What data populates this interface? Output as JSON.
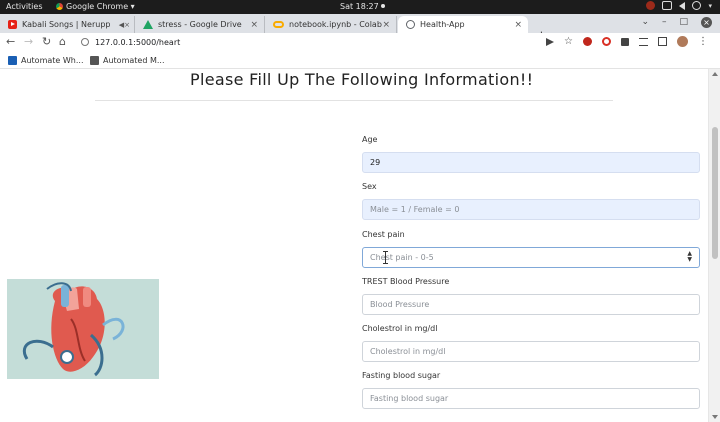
{
  "os_topbar": {
    "activities": "Activities",
    "app_name": "Google Chrome",
    "clock": "Sat 18:27"
  },
  "tabs": [
    {
      "title": "Kabali Songs | Nerupp",
      "icon": "youtube-icon",
      "media": "◀×"
    },
    {
      "title": "stress - Google Drive",
      "icon": "drive-icon"
    },
    {
      "title": "notebook.ipynb - Colabo",
      "icon": "colab-icon"
    },
    {
      "title": "Health-App",
      "icon": "globe-icon",
      "active": true
    }
  ],
  "toolbar": {
    "url": "127.0.0.1:5000/heart"
  },
  "bookmarks": [
    {
      "label": "Automate Wh...",
      "icon": "apps-icon"
    },
    {
      "label": "Automated M...",
      "icon": "document-icon"
    }
  ],
  "page": {
    "title": "Please Fill Up The Following Information!!",
    "image_colors": {
      "background": "#c4ddd8",
      "heart": "#e05a4f",
      "stethoscope": "#3b6e8f"
    },
    "form": {
      "fields": [
        {
          "label": "Age",
          "value": "29",
          "placeholder": ""
        },
        {
          "label": "Sex",
          "value": "",
          "placeholder": "Male = 1 / Female = 0"
        },
        {
          "label": "Chest pain",
          "value": "",
          "placeholder": "Chest pain - 0-5"
        },
        {
          "label": "TREST Blood Pressure",
          "value": "",
          "placeholder": "Blood Pressure"
        },
        {
          "label": "Cholestrol in mg/dl",
          "value": "",
          "placeholder": "Cholestrol in mg/dl"
        },
        {
          "label": "Fasting blood sugar",
          "value": "",
          "placeholder": "Fasting blood sugar"
        }
      ]
    }
  }
}
